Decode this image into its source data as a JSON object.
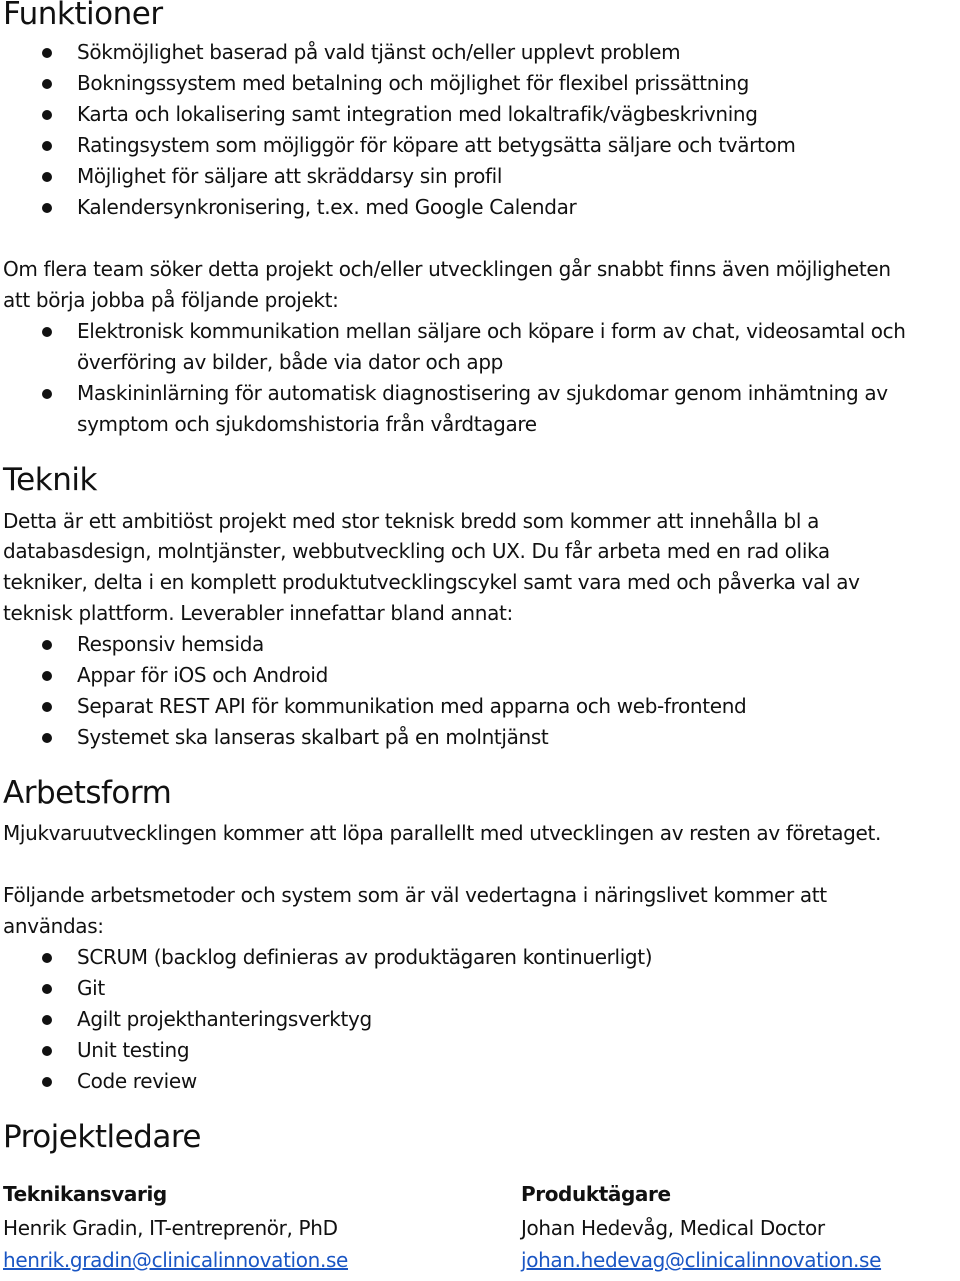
{
  "funktioner": {
    "heading": "Funktioner",
    "items": [
      "Sökmöjlighet baserad på vald tjänst och/eller upplevt problem",
      "Bokningssystem med betalning och möjlighet för flexibel prissättning",
      "Karta och lokalisering samt integration med lokaltrafik/vägbeskrivning",
      "Ratingsystem som möjliggör för köpare att betygsätta säljare och tvärtom",
      "Möjlighet för säljare att skräddarsy sin profil",
      "Kalendersynkronisering, t.ex. med Google Calendar"
    ],
    "extra_intro_lines": [
      "Om flera team söker detta projekt och/eller utvecklingen går snabbt finns även möjligheten",
      "att börja jobba på följande projekt:"
    ],
    "extra_items": [
      {
        "lines": [
          "Elektronisk kommunikation mellan säljare och köpare i form av chat, videosamtal och",
          "överföring av bilder, både via dator och app"
        ]
      },
      {
        "lines": [
          "Maskininlärning för automatisk diagnostisering av sjukdomar genom inhämtning av",
          "symptom och sjukdomshistoria från vårdtagare"
        ]
      }
    ]
  },
  "teknik": {
    "heading": "Teknik",
    "paragraph_lines": [
      "Detta är ett ambitiöst projekt med stor teknisk bredd som kommer att innehålla bl a",
      "databasdesign, molntjänster, webbutveckling och UX. Du får arbeta med en rad olika",
      "tekniker, delta i en komplett produktutvecklingscykel samt vara med och påverka val av",
      "teknisk plattform. Leverabler innefattar bland annat:"
    ],
    "items": [
      "Responsiv hemsida",
      "Appar för iOS och Android",
      "Separat REST API för kommunikation med apparna och web-frontend",
      "Systemet ska lanseras skalbart på en molntjänst"
    ]
  },
  "arbetsform": {
    "heading": "Arbetsform",
    "paragraph1": "Mjukvaruutvecklingen kommer att löpa parallellt med utvecklingen av resten av företaget.",
    "paragraph2_lines": [
      "Följande arbetsmetoder och system som är väl vedertagna i näringslivet kommer att",
      "användas:"
    ],
    "items": [
      "SCRUM (backlog definieras av produktägaren kontinuerligt)",
      "Git",
      "Agilt projekthanteringsverktyg",
      "Unit testing",
      "Code review"
    ]
  },
  "projektledare": {
    "heading": "Projektledare",
    "contacts": [
      {
        "role": "Teknikansvarig",
        "name": "Henrik Gradin, IT-entreprenör, PhD",
        "email": "henrik.gradin@clinicalinnovation.se"
      },
      {
        "role": "Produktägare",
        "name": "Johan Hedevåg, Medical Doctor",
        "email": "johan.hedevag@clinicalinnovation.se"
      }
    ]
  },
  "colors": {
    "text": "#111111",
    "link": "#1a56c4",
    "background": "#ffffff"
  }
}
